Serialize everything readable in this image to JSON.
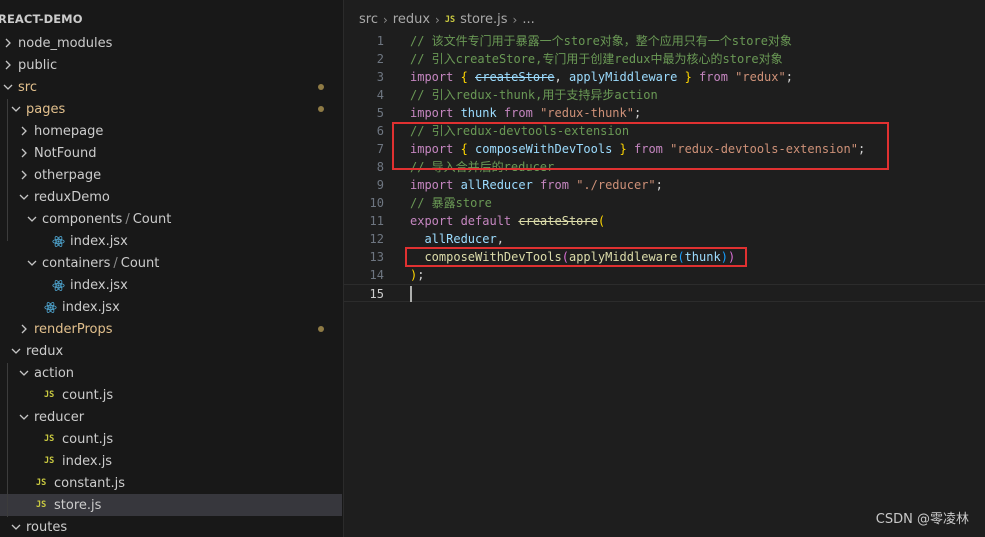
{
  "explorer": {
    "title": "REACT-DEMO",
    "items": [
      {
        "label": "node_modules",
        "kind": "folder",
        "expanded": false,
        "depth": 0
      },
      {
        "label": "public",
        "kind": "folder",
        "expanded": false,
        "depth": 0
      },
      {
        "label": "src",
        "kind": "folder",
        "expanded": true,
        "depth": 0,
        "modified": true
      },
      {
        "label": "pages",
        "kind": "folder",
        "expanded": true,
        "depth": 1,
        "modified": true
      },
      {
        "label": "homepage",
        "kind": "folder",
        "expanded": false,
        "depth": 2
      },
      {
        "label": "NotFound",
        "kind": "folder",
        "expanded": false,
        "depth": 2
      },
      {
        "label": "otherpage",
        "kind": "folder",
        "expanded": false,
        "depth": 2
      },
      {
        "label": "reduxDemo",
        "kind": "folder",
        "expanded": true,
        "depth": 2
      },
      {
        "label": "components",
        "label2": "Count",
        "kind": "folder",
        "expanded": true,
        "depth": 3
      },
      {
        "label": "index.jsx",
        "kind": "react",
        "depth": 4
      },
      {
        "label": "containers",
        "label2": "Count",
        "kind": "folder",
        "expanded": true,
        "depth": 3
      },
      {
        "label": "index.jsx",
        "kind": "react",
        "depth": 4
      },
      {
        "label": "index.jsx",
        "kind": "react",
        "depth": 3
      },
      {
        "label": "renderProps",
        "kind": "folder",
        "expanded": false,
        "depth": 2,
        "modified": true
      },
      {
        "label": "redux",
        "kind": "folder",
        "expanded": true,
        "depth": 1
      },
      {
        "label": "action",
        "kind": "folder",
        "expanded": true,
        "depth": 2
      },
      {
        "label": "count.js",
        "kind": "js",
        "depth": 3
      },
      {
        "label": "reducer",
        "kind": "folder",
        "expanded": true,
        "depth": 2
      },
      {
        "label": "count.js",
        "kind": "js",
        "depth": 3
      },
      {
        "label": "index.js",
        "kind": "js",
        "depth": 3
      },
      {
        "label": "constant.js",
        "kind": "js",
        "depth": 2
      },
      {
        "label": "store.js",
        "kind": "js",
        "depth": 2,
        "selected": true
      },
      {
        "label": "routes",
        "kind": "folder",
        "expanded": true,
        "depth": 1
      }
    ]
  },
  "breadcrumb": {
    "parts": [
      "src",
      "redux"
    ],
    "file_icon": "JS",
    "file": "store.js",
    "trailing": "..."
  },
  "js_icon_label": "JS",
  "editor": {
    "active_line": 15,
    "lines": [
      {
        "n": "1",
        "tokens": [
          [
            "c",
            "// 该文件专门用于暴露一个store对象，整个应用只有一个store对象"
          ]
        ]
      },
      {
        "n": "2",
        "tokens": [
          [
            "c",
            "// 引入createStore,专门用于创建redux中最为核心的store对象"
          ]
        ]
      },
      {
        "n": "3",
        "tokens": [
          [
            "k",
            "import "
          ],
          [
            "b1",
            "{ "
          ],
          [
            "vs",
            "createStore"
          ],
          [
            "p",
            ", "
          ],
          [
            "v",
            "applyMiddleware "
          ],
          [
            "b1",
            "}"
          ],
          [
            "k",
            " from "
          ],
          [
            "s",
            "\"redux\""
          ],
          [
            "p",
            ";"
          ]
        ]
      },
      {
        "n": "4",
        "tokens": [
          [
            "c",
            "// 引入redux-thunk,用于支持异步action"
          ]
        ]
      },
      {
        "n": "5",
        "tokens": [
          [
            "k",
            "import "
          ],
          [
            "v",
            "thunk"
          ],
          [
            "k",
            " from "
          ],
          [
            "s",
            "\"redux-thunk\""
          ],
          [
            "p",
            ";"
          ]
        ]
      },
      {
        "n": "6",
        "tokens": [
          [
            "c",
            "// 引入redux-devtools-extension"
          ]
        ]
      },
      {
        "n": "7",
        "tokens": [
          [
            "k",
            "import "
          ],
          [
            "b1",
            "{ "
          ],
          [
            "v",
            "composeWithDevTools "
          ],
          [
            "b1",
            "}"
          ],
          [
            "k",
            " from "
          ],
          [
            "s",
            "\"redux-devtools-extension\""
          ],
          [
            "p",
            ";"
          ]
        ]
      },
      {
        "n": "8",
        "tokens": [
          [
            "c",
            "// 导入合并后的reducer"
          ]
        ]
      },
      {
        "n": "9",
        "tokens": [
          [
            "k",
            "import "
          ],
          [
            "v",
            "allReducer"
          ],
          [
            "k",
            " from "
          ],
          [
            "s",
            "\"./reducer\""
          ],
          [
            "p",
            ";"
          ]
        ]
      },
      {
        "n": "10",
        "tokens": [
          [
            "c",
            "// 暴露store"
          ]
        ]
      },
      {
        "n": "11",
        "tokens": [
          [
            "k",
            "export default "
          ],
          [
            "fs",
            "createStore"
          ],
          [
            "b1",
            "("
          ]
        ]
      },
      {
        "n": "12",
        "tokens": [
          [
            "p",
            "  "
          ],
          [
            "v",
            "allReducer"
          ],
          [
            "p",
            ","
          ]
        ]
      },
      {
        "n": "13",
        "tokens": [
          [
            "p",
            "  "
          ],
          [
            "f",
            "composeWithDevTools"
          ],
          [
            "b2",
            "("
          ],
          [
            "f",
            "applyMiddleware"
          ],
          [
            "b3",
            "("
          ],
          [
            "v",
            "thunk"
          ],
          [
            "b3",
            ")"
          ],
          [
            "b2",
            ")"
          ]
        ]
      },
      {
        "n": "14",
        "tokens": [
          [
            "b1",
            ")"
          ],
          [
            "p",
            ";"
          ]
        ]
      },
      {
        "n": "15",
        "tokens": []
      }
    ]
  },
  "watermark": "CSDN @零凌林",
  "colors": {
    "highlight_box": "#e03131",
    "comment": "#6a9955",
    "keyword": "#c586c0",
    "string": "#ce9178",
    "modified_folder": "#e2c08d"
  }
}
